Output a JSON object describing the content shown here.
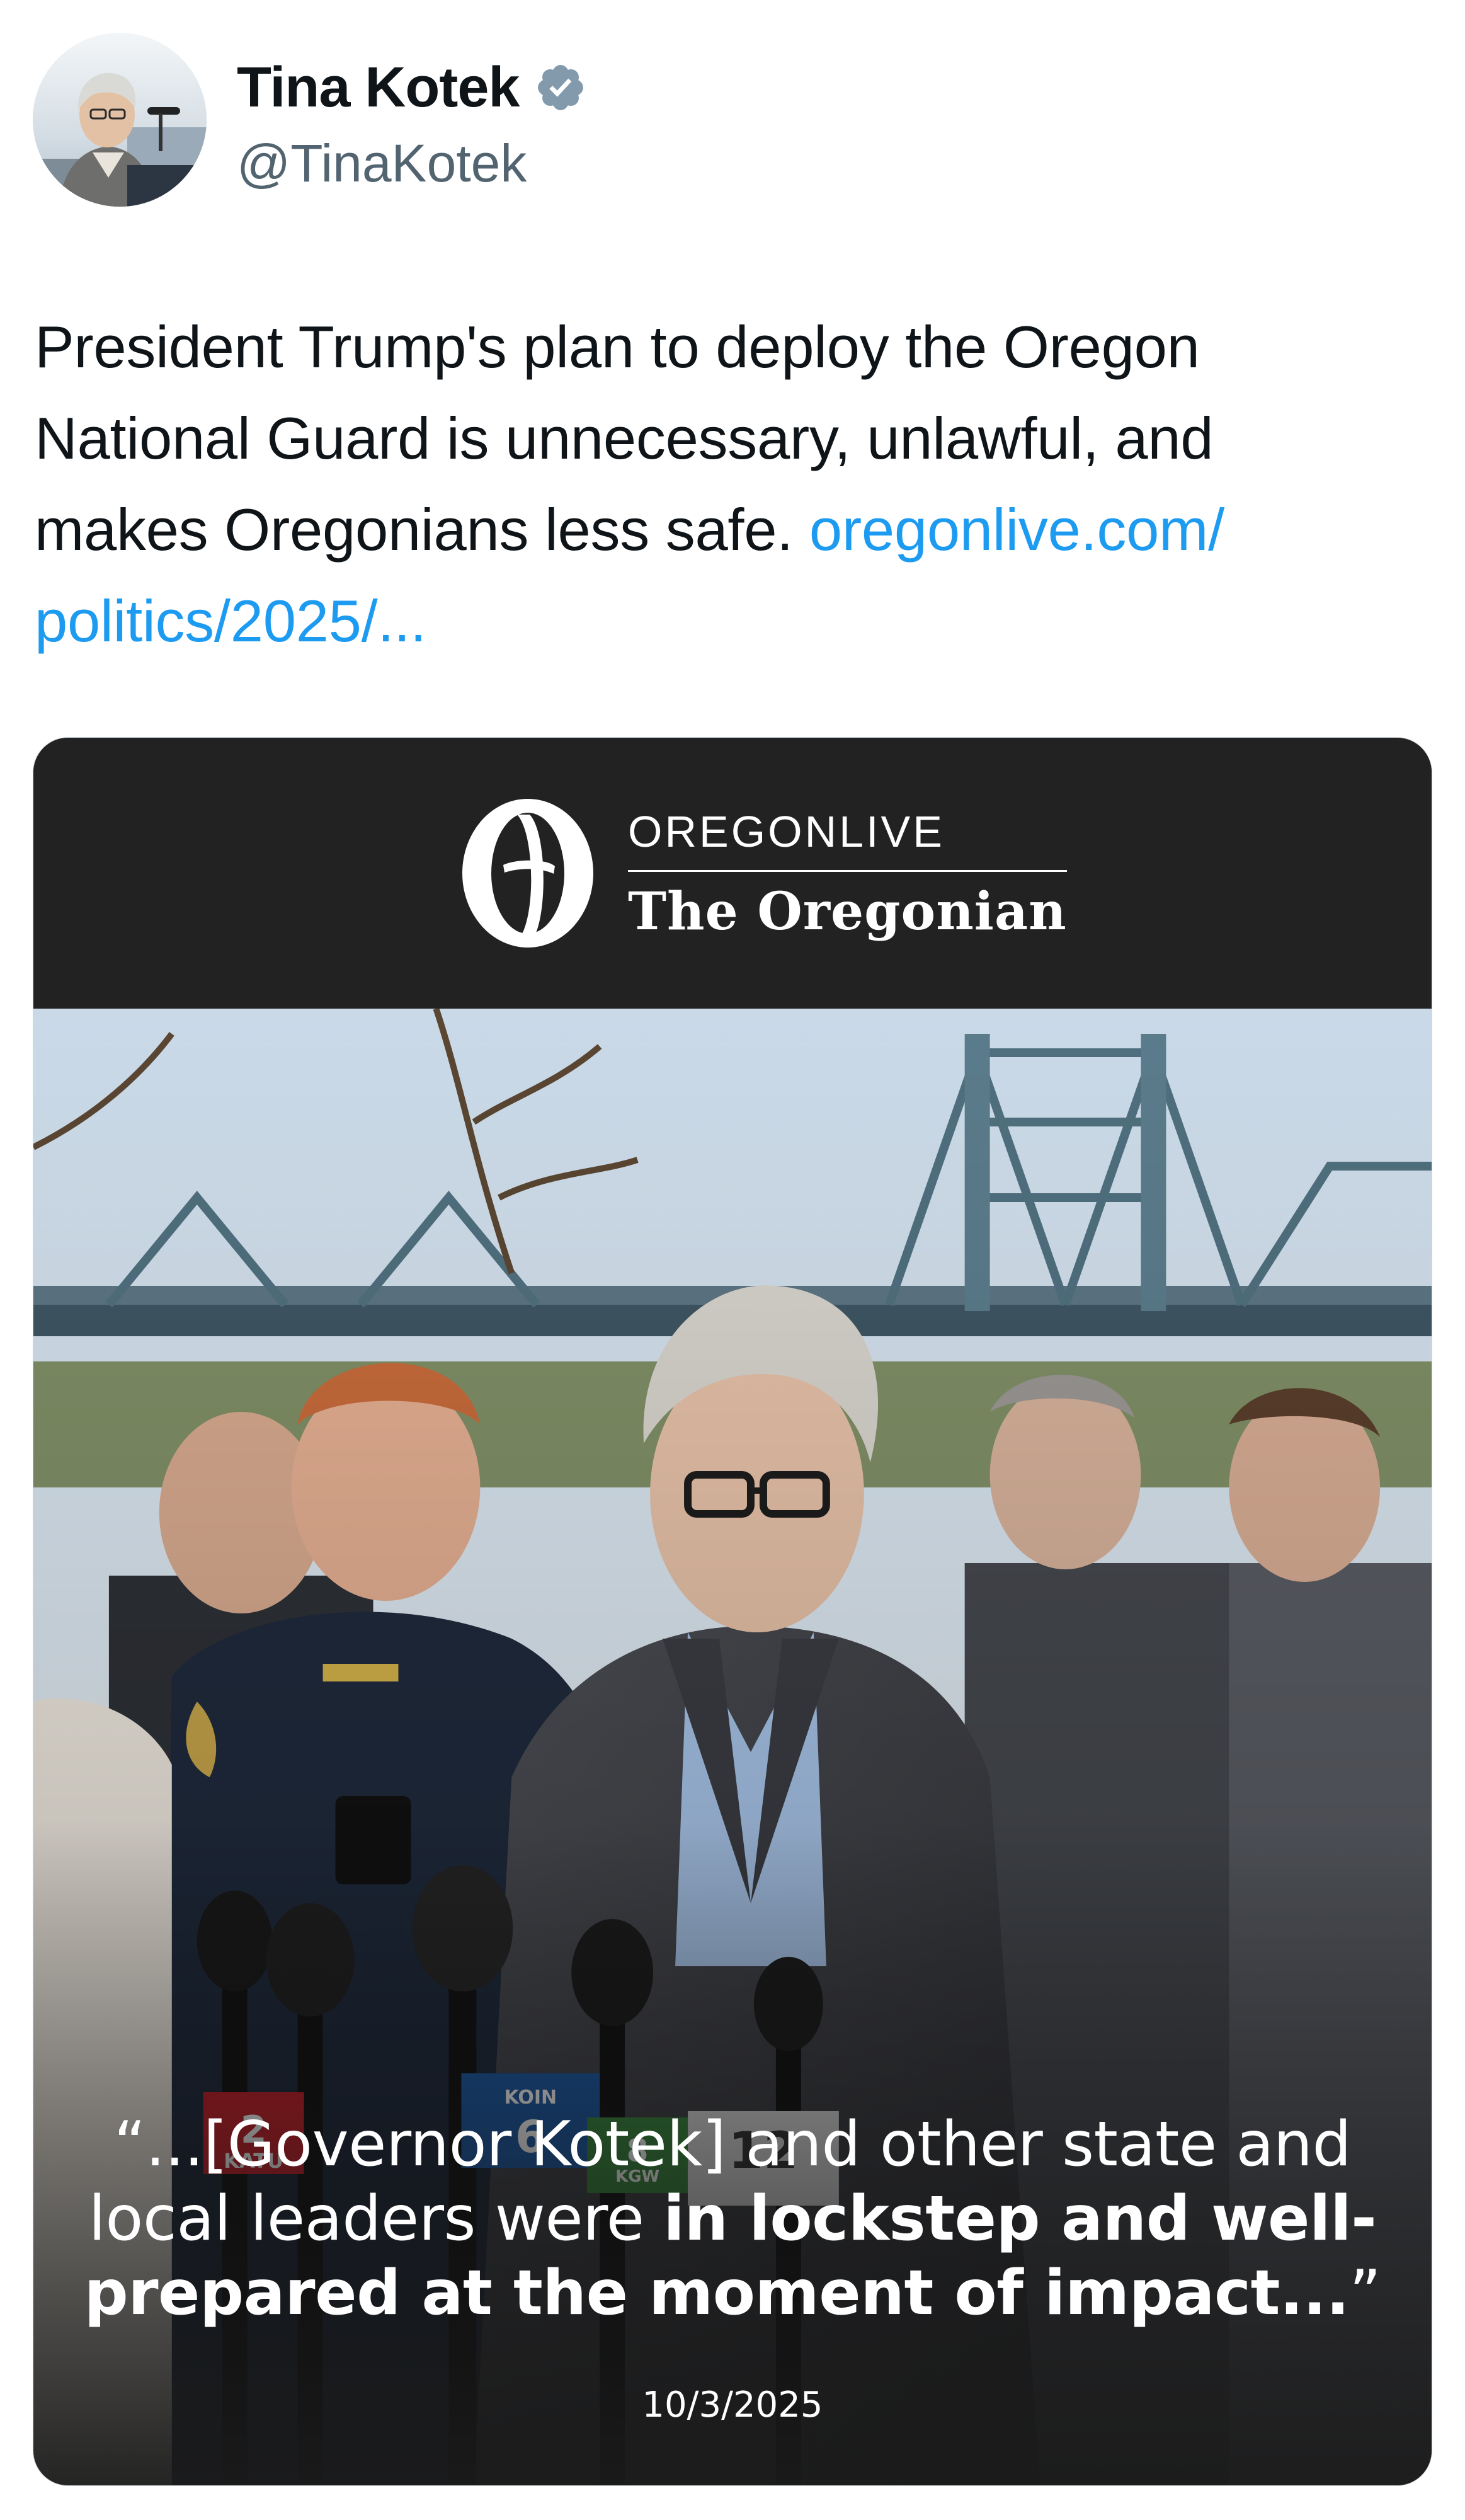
{
  "author": {
    "display_name": "Tina Kotek",
    "handle": "@TinaKotek",
    "verified": true,
    "avatar_icon": "profile-photo-icon",
    "verified_icon": "verified-badge-icon"
  },
  "tweet": {
    "text_line1": "President Trump's plan to deploy the Oregon",
    "text_line2": "National Guard is unnecessary, unlawful, and",
    "text_line3_prefix": "makes Oregonians less safe.",
    "link_part1": "oregonlive.com/",
    "link_part2": "politics/2025/..."
  },
  "media": {
    "brand_top": "OREGONLIVE",
    "brand_bottom": "The Oregonian",
    "brand_logo_icon": "oregonian-o-logo-icon",
    "quote_line1": "“...[Governor Kotek] and other state and",
    "quote_line2_regular": "local leaders were",
    "quote_line2_bold": "in lockstep and well-",
    "quote_line3_bold": "prepared at the moment of impact...",
    "quote_close": "”",
    "date": "10/3/2025",
    "mic_flags": [
      "2 KATU",
      "KOIN 6",
      "8 KGW",
      "12 NEWS"
    ]
  },
  "colors": {
    "link": "#1d9bf0",
    "verified": "#829aab",
    "card_background": "#222222",
    "text_primary": "#0f1419",
    "text_secondary": "#536471"
  }
}
